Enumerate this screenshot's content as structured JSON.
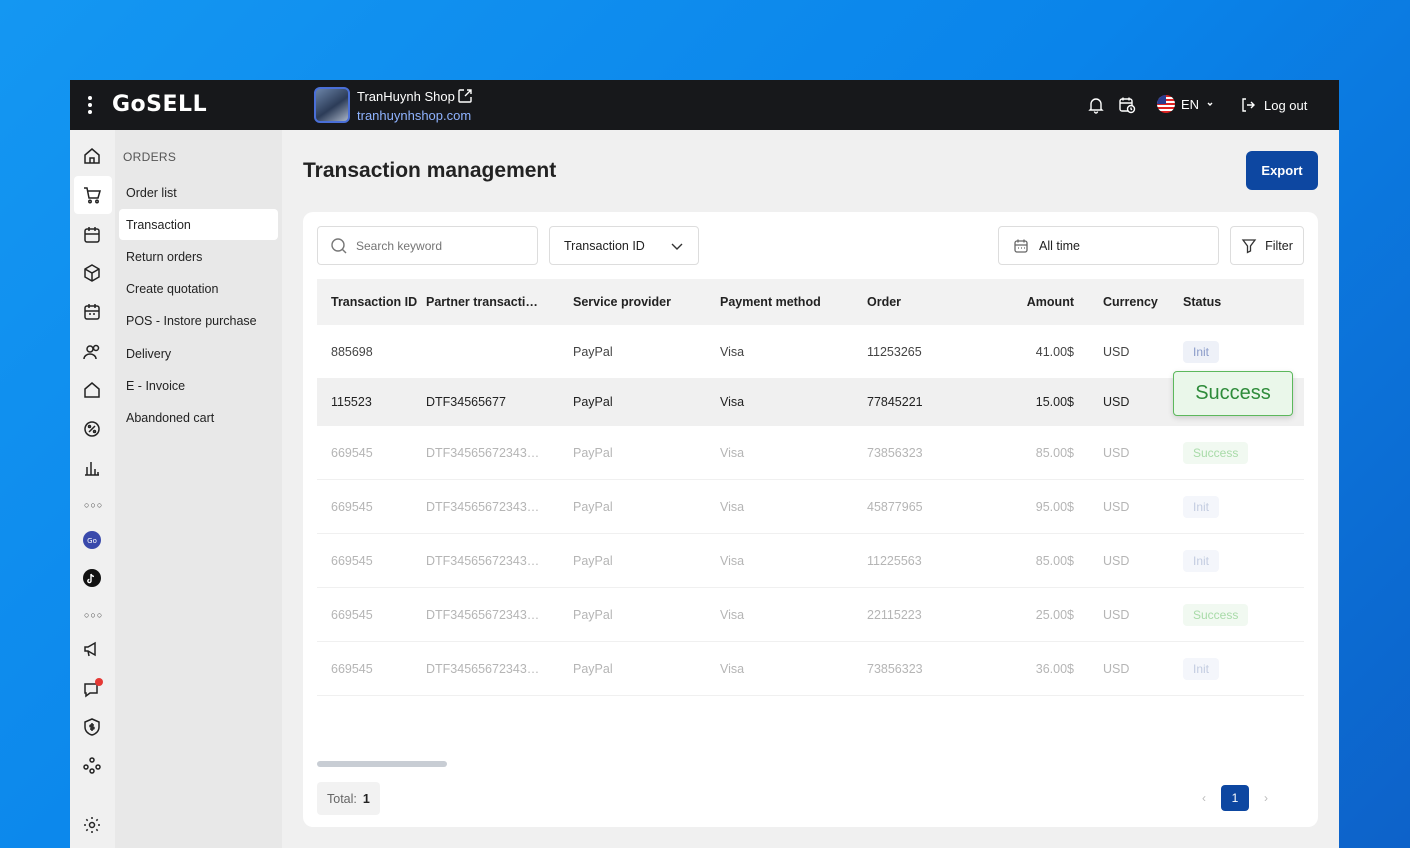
{
  "app": {
    "logo": "GoSELL"
  },
  "shop": {
    "name": "TranHuynh Shop",
    "url": "tranhuynhshop.com"
  },
  "topbar": {
    "language": "EN",
    "logout_label": "Log out"
  },
  "sidebar": {
    "section_title": "ORDERS",
    "items": [
      {
        "label": "Order list"
      },
      {
        "label": "Transaction"
      },
      {
        "label": "Return orders"
      },
      {
        "label": "Create quotation"
      },
      {
        "label": "POS - Instore purchase"
      },
      {
        "label": "Delivery"
      },
      {
        "label": "E - Invoice"
      },
      {
        "label": "Abandoned cart"
      }
    ]
  },
  "page": {
    "title": "Transaction management",
    "export_label": "Export"
  },
  "filters": {
    "search_placeholder": "Search keyword",
    "search_by": "Transaction ID",
    "date_range": "All time",
    "filter_label": "Filter"
  },
  "table": {
    "headers": [
      "Transaction ID",
      "Partner transaction ID",
      "Service provider",
      "Payment method",
      "Order",
      "Amount",
      "Currency",
      "Status"
    ],
    "rows": [
      {
        "id": "885698",
        "partner": "",
        "provider": "PayPal",
        "method": "Visa",
        "order": "11253265",
        "amount": "41.00$",
        "currency": "USD",
        "status": "Init"
      },
      {
        "id": "115523",
        "partner": "DTF34565677",
        "provider": "PayPal",
        "method": "Visa",
        "order": "77845221",
        "amount": "15.00$",
        "currency": "USD",
        "status": "Success"
      },
      {
        "id": "669545",
        "partner": "DTF345656723436...",
        "provider": "PayPal",
        "method": "Visa",
        "order": "73856323",
        "amount": "85.00$",
        "currency": "USD",
        "status": "Success"
      },
      {
        "id": "669545",
        "partner": "DTF345656723436...",
        "provider": "PayPal",
        "method": "Visa",
        "order": "45877965",
        "amount": "95.00$",
        "currency": "USD",
        "status": "Init"
      },
      {
        "id": "669545",
        "partner": "DTF345656723436...",
        "provider": "PayPal",
        "method": "Visa",
        "order": "11225563",
        "amount": "85.00$",
        "currency": "USD",
        "status": "Init"
      },
      {
        "id": "669545",
        "partner": "DTF345656723436...",
        "provider": "PayPal",
        "method": "Visa",
        "order": "22115223",
        "amount": "25.00$",
        "currency": "USD",
        "status": "Success"
      },
      {
        "id": "669545",
        "partner": "DTF345656723436...",
        "provider": "PayPal",
        "method": "Visa",
        "order": "73856323",
        "amount": "36.00$",
        "currency": "USD",
        "status": "Init"
      }
    ]
  },
  "highlight_badge": "Success",
  "footer": {
    "total_label": "Total:",
    "total_value": "1",
    "current_page": "1"
  },
  "colors": {
    "primary": "#0d47a1",
    "topbar": "#17181b",
    "success": "#5cb85c",
    "init": "#8a9bc9"
  }
}
